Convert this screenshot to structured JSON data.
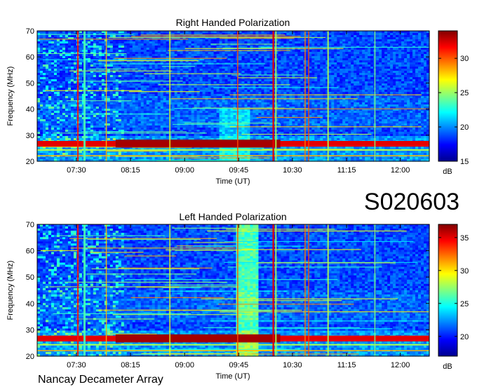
{
  "observation_id": "S020603",
  "footer": "Nancay Decameter Array",
  "chart_data": [
    {
      "type": "heatmap",
      "title": "Right Handed Polarization",
      "xlabel": "Time (UT)",
      "ylabel": "Frequency (MHz)",
      "x_ticks": [
        "07:30",
        "08:15",
        "09:00",
        "09:45",
        "10:30",
        "11:15",
        "12:00"
      ],
      "y_ticks": [
        20,
        30,
        40,
        50,
        60,
        70
      ],
      "ylim": [
        20,
        70
      ],
      "colorbar": {
        "label": "dB",
        "ticks": [
          15,
          20,
          25,
          30
        ],
        "range": [
          15,
          34
        ]
      }
    },
    {
      "type": "heatmap",
      "title": "Left Handed Polarization",
      "xlabel": "Time (UT)",
      "ylabel": "Frequency (MHz)",
      "x_ticks": [
        "07:30",
        "08:15",
        "09:00",
        "09:45",
        "10:30",
        "11:15",
        "12:00"
      ],
      "y_ticks": [
        20,
        30,
        40,
        50,
        60,
        70
      ],
      "ylim": [
        20,
        70
      ],
      "colorbar": {
        "label": "dB",
        "ticks": [
          20,
          25,
          30,
          35
        ],
        "range": [
          17,
          37
        ]
      }
    }
  ]
}
